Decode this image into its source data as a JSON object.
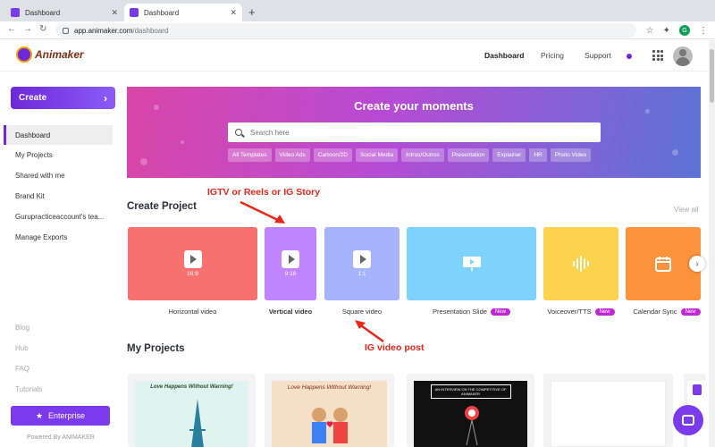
{
  "browser": {
    "tabs": [
      {
        "label": "Dashboard",
        "active": false
      },
      {
        "label": "Dashboard",
        "active": true
      }
    ],
    "url_host": "app.animaker.com",
    "url_path": "/dashboard",
    "profile_initial": "G"
  },
  "header": {
    "logo_text": "Animaker",
    "nav": [
      "Dashboard",
      "Pricing",
      "Support"
    ]
  },
  "sidebar": {
    "create_label": "Create",
    "items": [
      "Dashboard",
      "My Projects",
      "Shared with me",
      "Brand Kit",
      "Gurupracticeaccount's tea...",
      "Manage Exports"
    ],
    "footer_links": [
      "Blog",
      "Hub",
      "FAQ",
      "Tutorials"
    ],
    "enterprise_label": "Enterprise",
    "powered_by": "Powered By ANIMAKER"
  },
  "hero": {
    "title": "Create your moments",
    "search_placeholder": "Search here",
    "chips": [
      "All Templates",
      "Video Ads",
      "Cartoon/2D",
      "Social Media",
      "Intros/Outros",
      "Presentation",
      "Explainer",
      "HR",
      "Photo Video"
    ]
  },
  "create_project": {
    "title": "Create Project",
    "view_all": "View all",
    "cards": [
      {
        "label": "Horizontal video",
        "ratio": "16:9",
        "color": "#f87171",
        "new": false,
        "bold": false
      },
      {
        "label": "Vertical video",
        "ratio": "9:16",
        "color": "#c084fc",
        "new": false,
        "bold": true
      },
      {
        "label": "Square video",
        "ratio": "1:1",
        "color": "#a5b4fc",
        "new": false,
        "bold": false
      },
      {
        "label": "Presentation Slide",
        "ratio": "",
        "color": "#7dd3fc",
        "new": true,
        "bold": false
      },
      {
        "label": "Voiceover/TTS",
        "ratio": "",
        "color": "#fcd34d",
        "new": true,
        "bold": false
      },
      {
        "label": "Calendar Sync",
        "ratio": "",
        "color": "#fb923c",
        "new": true,
        "bold": false
      }
    ],
    "new_badge": "New"
  },
  "annotations": {
    "top": "IGTV or Reels or IG Story",
    "bottom": "IG video post"
  },
  "my_projects": {
    "title": "My Projects",
    "thumbs": [
      {
        "caption": "Love Happens Without Warning!"
      },
      {
        "caption": "Love Happens Without Warning!"
      },
      {
        "caption": "AN INTERVIEW ON THE COMPETITIVE OF ANIMAKER"
      }
    ]
  },
  "colors": {
    "brand": "#6d28d9",
    "annotation": "#e8261b"
  }
}
